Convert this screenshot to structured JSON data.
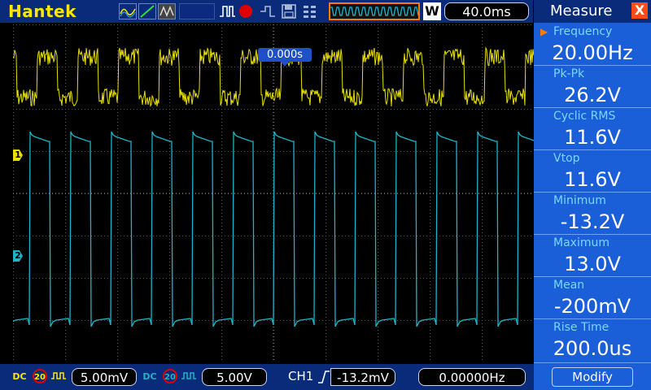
{
  "header": {
    "brand": "Hantek",
    "timebase": "40.0ms",
    "w_label": "W"
  },
  "icons": {
    "record_color": "#e00000",
    "timeline_border": "#ff7a00"
  },
  "screen": {
    "trigger_time": "0.000s",
    "ch1_marker": "1",
    "ch2_marker": "2",
    "ch1_color": "#e8e000",
    "ch2_color": "#20b4c8"
  },
  "measure": {
    "title": "Measure",
    "close_label": "X",
    "items": [
      {
        "label": "Frequency",
        "value": "20.00Hz"
      },
      {
        "label": "Pk-Pk",
        "value": "26.2V"
      },
      {
        "label": "Cyclic RMS",
        "value": "11.6V"
      },
      {
        "label": "Vtop",
        "value": "11.6V"
      },
      {
        "label": "Minimum",
        "value": "-13.2V"
      },
      {
        "label": "Maximum",
        "value": "13.0V"
      },
      {
        "label": "Mean",
        "value": "-200mV"
      },
      {
        "label": "Rise Time",
        "value": "200.0us"
      }
    ],
    "modify_label": "Modify"
  },
  "footer": {
    "ch1_coupling": "DC",
    "ch1_bw": "20",
    "ch1_scale": "5.00mV",
    "ch2_coupling": "DC",
    "ch2_bw": "20",
    "ch2_scale": "5.00V",
    "trigger_source": "CH1",
    "trigger_level": "-13.2mV",
    "trigger_freq": "0.00000Hz"
  }
}
